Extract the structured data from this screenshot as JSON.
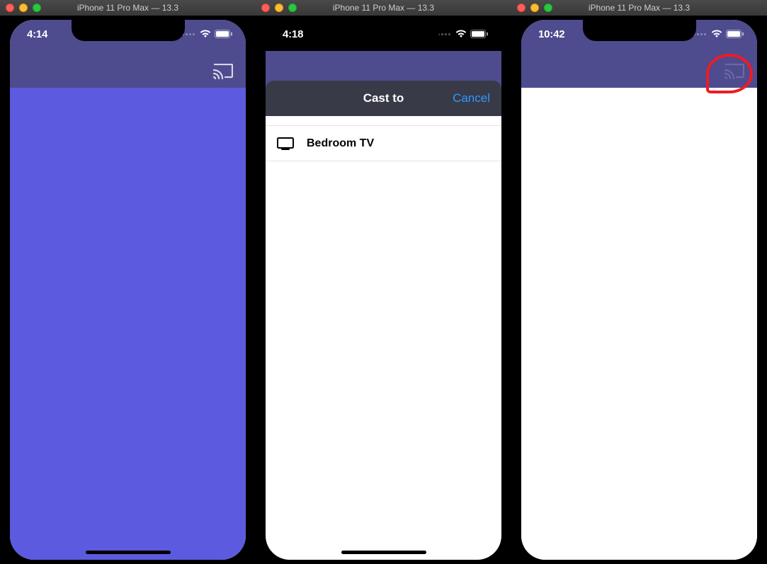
{
  "simulators": [
    {
      "window_title": "iPhone 11 Pro Max — 13.3",
      "status": {
        "time": "4:14"
      },
      "nav": {
        "cast_icon": "cast-icon",
        "cast_light": true
      },
      "content": "purple"
    },
    {
      "window_title": "iPhone 11 Pro Max — 13.3",
      "status": {
        "time": "4:18"
      },
      "sheet": {
        "title": "Cast to",
        "cancel": "Cancel",
        "devices": [
          {
            "icon": "tv-icon",
            "name": "Bedroom TV"
          }
        ]
      }
    },
    {
      "window_title": "iPhone 11 Pro Max — 13.3",
      "status": {
        "time": "10:42"
      },
      "nav": {
        "cast_icon": "cast-icon",
        "cast_light": false
      },
      "content": "white",
      "annotation": true
    }
  ]
}
